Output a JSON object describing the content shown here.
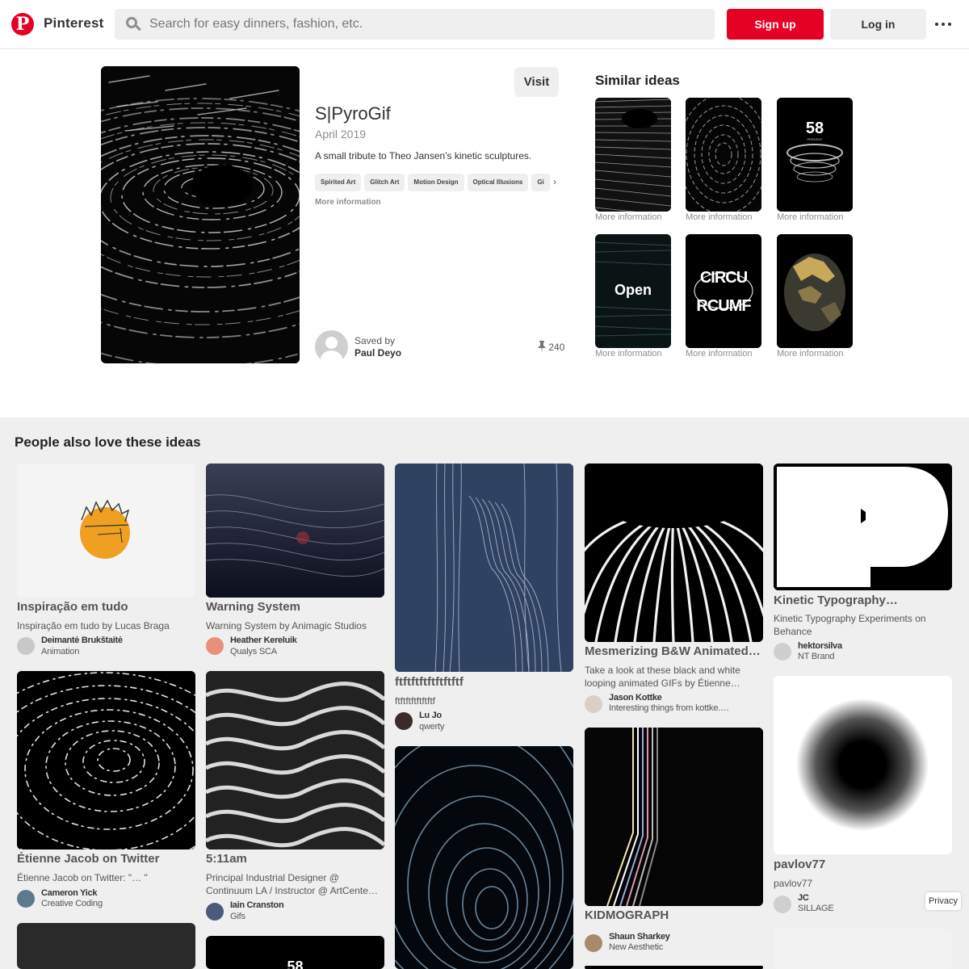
{
  "header": {
    "brand": "Pinterest",
    "logo_letter": "P",
    "search_placeholder": "Search for easy dinners, fashion, etc.",
    "signup_label": "Sign up",
    "login_label": "Log in",
    "accent_color": "#e60023"
  },
  "pin": {
    "visit_label": "Visit",
    "title": "S|PyroGif",
    "date": "April 2019",
    "description": "A small tribute to Theo Jansen's kinetic sculptures.",
    "tags": [
      "Spirited Art",
      "Glitch Art",
      "Motion Design",
      "Optical Illusions",
      "Gi"
    ],
    "more_info": "More information",
    "saved_by_label": "Saved by",
    "saver_name": "Paul Deyo",
    "pin_count": "240"
  },
  "similar": {
    "title": "Similar ideas",
    "more_info": "More information",
    "items": [
      {
        "icon": "black-hole-streaks"
      },
      {
        "icon": "wavy-vortex"
      },
      {
        "icon": "percent-ring",
        "label": "58",
        "sublabel": "PERCENT"
      },
      {
        "icon": "open-text",
        "label": "Open"
      },
      {
        "icon": "circumference-type",
        "label": "CIRCU",
        "label2": "RCUMF"
      },
      {
        "icon": "gold-rock"
      }
    ]
  },
  "feed": {
    "title": "People also love these ideas",
    "cards": [
      {
        "title": "Inspiração em tudo",
        "desc": "Inspiração em tudo by Lucas Braga",
        "user": "Deimantė Brukštaitė",
        "board": "Animation"
      },
      {
        "title": "Warning System",
        "desc": "Warning System by Animagic Studios",
        "user": "Heather Kereluik",
        "board": "Qualys SCA"
      },
      {
        "title": "ftftftftftftftftf",
        "desc": "ftftftftftftftf",
        "user": "Lu Jo",
        "board": "qwerty"
      },
      {
        "title": "Mesmerizing B&W Animated…",
        "desc": "Take a look at these black and white looping animated GIFs by Étienne…",
        "user": "Jason Kottke",
        "board": "Interesting things from kottke.…"
      },
      {
        "title": "Kinetic Typography…",
        "desc": "Kinetic Typography Experiments on Behance",
        "user": "hektorsilva",
        "board": "NT Brand"
      },
      {
        "title": "Étienne Jacob on Twitter",
        "desc": "Étienne Jacob on Twitter: \"… \"",
        "user": "Cameron Yick",
        "board": "Creative Coding"
      },
      {
        "title": "5:11am",
        "desc": "Principal Industrial Designer @ Continuum LA / Instructor @ ArtCente…",
        "user": "Iain Cranston",
        "board": "Gifs"
      },
      {
        "title": "KIDMOGRAPH",
        "desc": "",
        "user": "Shaun Sharkey",
        "board": "New Aesthetic"
      },
      {
        "title": "pavlov77",
        "desc": "pavlov77",
        "user": "JC",
        "board": "SILLAGE"
      }
    ],
    "next_peek_label": "58"
  },
  "privacy_label": "Privacy"
}
